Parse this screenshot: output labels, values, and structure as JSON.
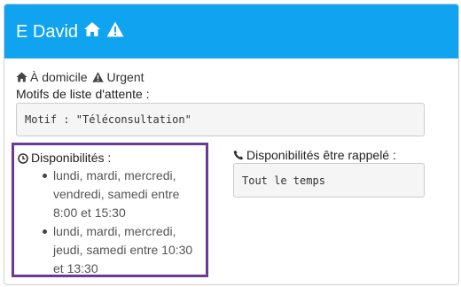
{
  "header": {
    "title": "E David",
    "bg_color": "#10a3f0",
    "icons": [
      "home-icon",
      "warning-icon"
    ]
  },
  "tags": [
    {
      "icon": "home-icon",
      "label": "À domicile"
    },
    {
      "icon": "warning-icon",
      "label": "Urgent"
    }
  ],
  "waitlist": {
    "label": "Motifs de liste d'attente :",
    "value": "Motif : \"Téléconsultation\""
  },
  "availability": {
    "icon": "clock-icon",
    "label": "Disponibilités :",
    "highlight_color": "#6b3a99",
    "slots": [
      "lundi, mardi, mercredi, vendredi, samedi entre 8:00 et 15:30",
      "lundi, mardi, mercredi, jeudi, samedi entre 10:30 et 13:30"
    ]
  },
  "callback": {
    "icon": "phone-icon",
    "label": "Disponibilités être rappelé :",
    "value": "Tout le temps"
  }
}
